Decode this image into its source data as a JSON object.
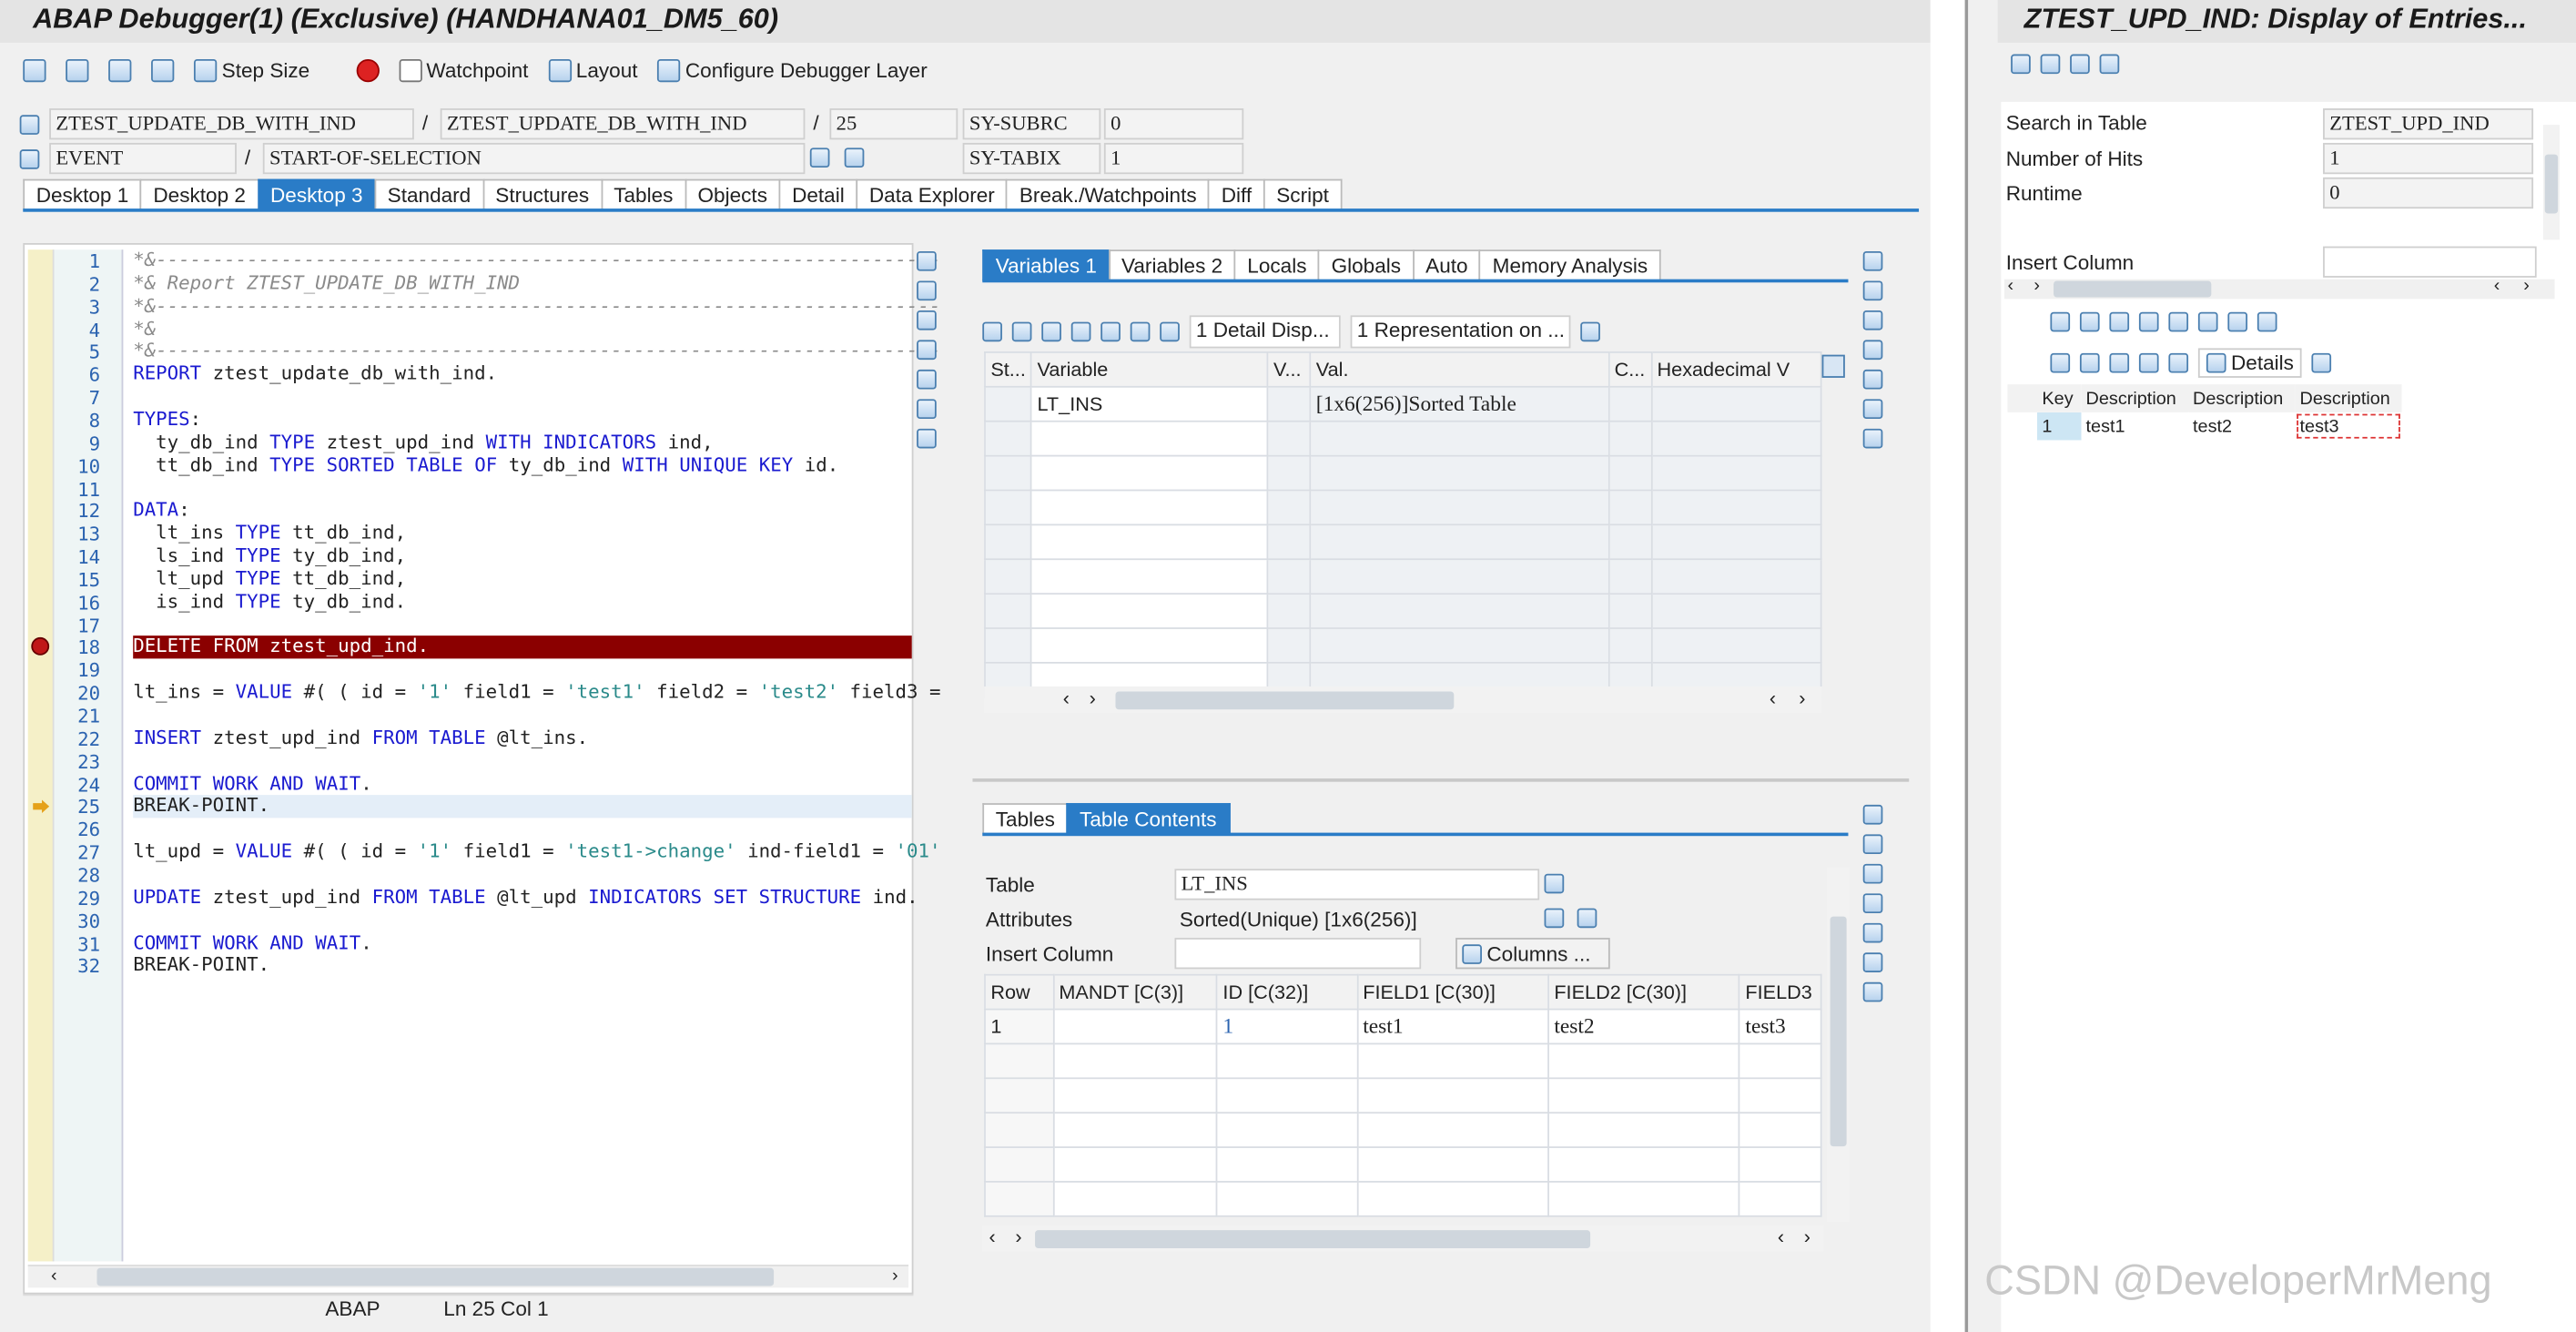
{
  "debugger": {
    "title": "ABAP Debugger(1)  (Exclusive) (HANDHANA01_DM5_60)",
    "toolbar": {
      "step_size": "Step Size",
      "watchpoint": "Watchpoint",
      "layout": "Layout",
      "configure": "Configure Debugger Layer"
    },
    "program": "ZTEST_UPDATE_DB_WITH_IND",
    "include": "ZTEST_UPDATE_DB_WITH_IND",
    "line": "25",
    "event_type": "EVENT",
    "event": "START-OF-SELECTION",
    "sy_subrc_label": "SY-SUBRC",
    "sy_subrc": "0",
    "sy_tabix_label": "SY-TABIX",
    "sy_tabix": "1",
    "desktop_tabs": [
      "Desktop 1",
      "Desktop 2",
      "Desktop 3",
      "Standard",
      "Structures",
      "Tables",
      "Objects",
      "Detail",
      "Data Explorer",
      "Break./Watchpoints",
      "Diff",
      "Script"
    ],
    "code_lines": [
      "*&---------------------------------------------------------------------",
      "*& Report ZTEST_UPDATE_DB_WITH_IND",
      "*&---------------------------------------------------------------------",
      "*&",
      "*&---------------------------------------------------------------------",
      "REPORT ztest_update_db_with_ind.",
      "",
      "TYPES:",
      "  ty_db_ind TYPE ztest_upd_ind WITH INDICATORS ind,",
      "  tt_db_ind TYPE SORTED TABLE OF ty_db_ind WITH UNIQUE KEY id.",
      "",
      "DATA:",
      "  lt_ins TYPE tt_db_ind,",
      "  ls_ind TYPE ty_db_ind,",
      "  lt_upd TYPE tt_db_ind,",
      "  is_ind TYPE ty_db_ind.",
      "",
      "DELETE FROM ztest_upd_ind.",
      "",
      "lt_ins = VALUE #( ( id = '1' field1 = 'test1' field2 = 'test2' field3 =",
      "",
      "INSERT ztest_upd_ind FROM TABLE @lt_ins.",
      "",
      "COMMIT WORK AND WAIT.",
      "BREAK-POINT.",
      "",
      "lt_upd = VALUE #( ( id = '1' field1 = 'test1->change' ind-field1 = '01'",
      "",
      "UPDATE ztest_upd_ind FROM TABLE @lt_upd INDICATORS SET STRUCTURE ind.",
      "",
      "COMMIT WORK AND WAIT.",
      "BREAK-POINT."
    ],
    "status": {
      "lang": "ABAP",
      "pos": "Ln  25 Col   1"
    },
    "var_tabs": [
      "Variables 1",
      "Variables 2",
      "Locals",
      "Globals",
      "Auto",
      "Memory Analysis"
    ],
    "var_toolbar": {
      "detail": "1 Detail Disp...",
      "repr": "1 Representation on ..."
    },
    "var_headers": [
      "St...",
      "Variable",
      "V...",
      "Val.",
      "C...",
      "Hexadecimal V"
    ],
    "var_rows": [
      {
        "name": "LT_INS",
        "value": "[1x6(256)]Sorted Table"
      }
    ],
    "tbl_tabs": [
      "Tables",
      "Table Contents"
    ],
    "table_label": "Table",
    "table_value": "LT_INS",
    "attributes_label": "Attributes",
    "attributes_value": "Sorted(Unique) [1x6(256)]",
    "insert_col_label": "Insert Column",
    "columns_btn": "Columns ...",
    "tbl_headers": [
      "Row",
      "MANDT [C(3)]",
      "ID [C(32)]",
      "FIELD1 [C(30)]",
      "FIELD2 [C(30)]",
      "FIELD3"
    ],
    "tbl_rows": [
      [
        "1",
        "",
        "1",
        "test1",
        "test2",
        "test3"
      ]
    ]
  },
  "display": {
    "title": "ZTEST_UPD_IND: Display of Entries...",
    "search_label": "Search in Table",
    "search_value": "ZTEST_UPD_IND",
    "hits_label": "Number of Hits",
    "hits_value": "1",
    "runtime_label": "Runtime",
    "runtime_value": "0",
    "insert_label": "Insert Column",
    "details_btn": "Details",
    "headers": [
      "Key",
      "Description",
      "Description",
      "Description"
    ],
    "rows": [
      [
        "1",
        "test1",
        "test2",
        "test3"
      ]
    ]
  },
  "watermark": "CSDN @DeveloperMrMeng",
  "colors": {
    "accent": "#2a7cc7",
    "breakpoint_line": "#8b0000",
    "current_line": "#e4eef8"
  }
}
